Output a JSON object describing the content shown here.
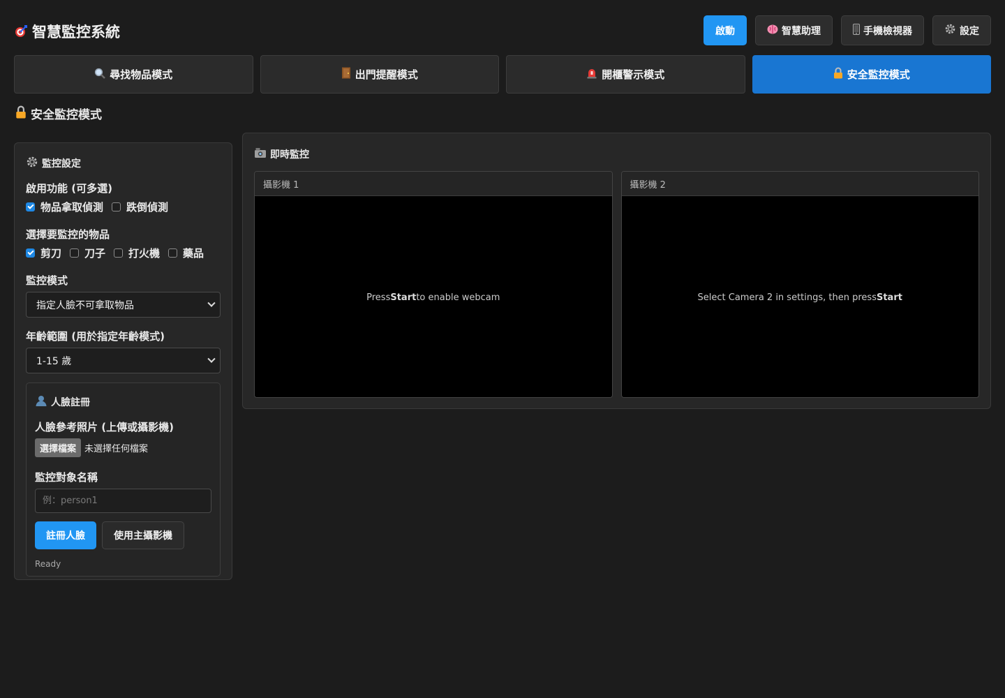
{
  "header": {
    "title": "智慧監控系統",
    "buttons": {
      "start": "啟動",
      "assistant": "智慧助理",
      "mobile": "手機檢視器",
      "settings": "設定"
    }
  },
  "modes": [
    {
      "label": "尋找物品模式",
      "icon": "magnifier-icon",
      "active": false
    },
    {
      "label": "出門提醒模式",
      "icon": "door-icon",
      "active": false
    },
    {
      "label": "開櫃警示模式",
      "icon": "siren-icon",
      "active": false
    },
    {
      "label": "安全監控模式",
      "icon": "lock-icon",
      "active": true
    }
  ],
  "section_title": "安全監控模式",
  "settings_panel": {
    "heading": "監控設定",
    "features_label": "啟用功能 (可多選)",
    "features": [
      {
        "label": "物品拿取偵測",
        "checked": true
      },
      {
        "label": "跌倒偵測",
        "checked": false
      }
    ],
    "items_label": "選擇要監控的物品",
    "items": [
      {
        "label": "剪刀",
        "checked": true
      },
      {
        "label": "刀子",
        "checked": false
      },
      {
        "label": "打火機",
        "checked": false
      },
      {
        "label": "藥品",
        "checked": false
      }
    ],
    "mode_label": "監控模式",
    "mode_value": "指定人臉不可拿取物品",
    "age_label": "年齡範圍 (用於指定年齡模式)",
    "age_value": "1-15 歲"
  },
  "face_registration": {
    "heading": "人臉註冊",
    "photo_label": "人臉參考照片 (上傳或攝影機)",
    "file_button": "選擇檔案",
    "file_status": "未選擇任何檔案",
    "name_label": "監控對象名稱",
    "name_placeholder": "例：person1",
    "register_button": "註冊人臉",
    "use_camera_button": "使用主攝影機",
    "status": "Ready"
  },
  "live_panel": {
    "heading": "即時監控",
    "cameras": [
      {
        "title": "攝影機 1",
        "msg_before": "Press",
        "msg_bold": "Start",
        "msg_after": "to enable webcam"
      },
      {
        "title": "攝影機 2",
        "msg_before": "Select Camera 2 in settings, then press",
        "msg_bold": "Start",
        "msg_after": ""
      }
    ]
  },
  "colors": {
    "accent": "#2196f3",
    "active_tab": "#1976d2",
    "background": "#1c1c1c"
  }
}
